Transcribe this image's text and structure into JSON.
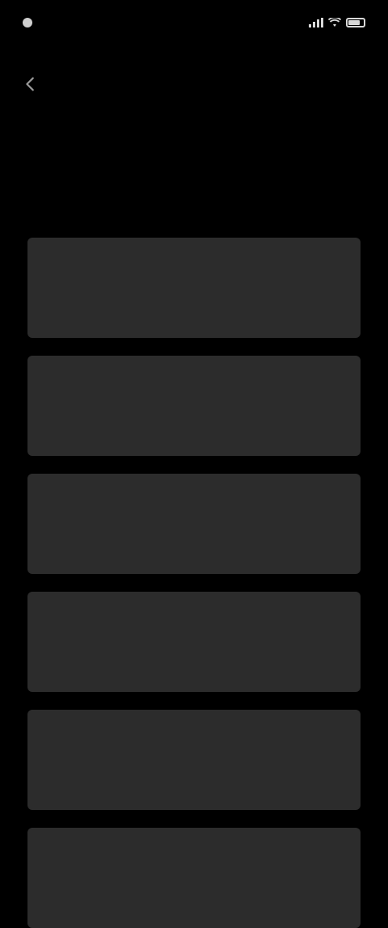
{
  "status_bar": {
    "time": "",
    "icons": [
      "signal-icon",
      "wifi-icon",
      "battery-icon"
    ]
  },
  "nav": {
    "back_icon": "back-arrow-icon"
  },
  "title": "",
  "options": [
    {
      "title": "",
      "description": ""
    },
    {
      "title": "",
      "description": ""
    },
    {
      "title": "",
      "description": ""
    },
    {
      "title": "",
      "description": ""
    },
    {
      "title": "",
      "description": ""
    },
    {
      "title": "",
      "description": ""
    }
  ],
  "colors": {
    "background": "#000000",
    "card": "#2c2c2c",
    "text_primary": "#ffffff",
    "text_secondary": "#b4b4b4"
  }
}
